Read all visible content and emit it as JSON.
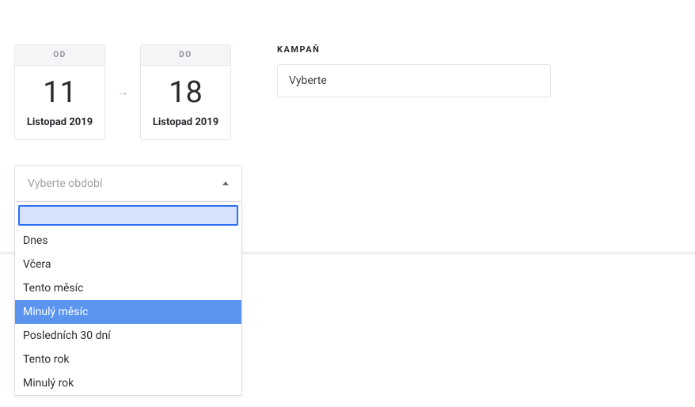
{
  "dateRange": {
    "from": {
      "label": "OD",
      "day": "11",
      "monthYear": "Listopad 2019"
    },
    "to": {
      "label": "DO",
      "day": "18",
      "monthYear": "Listopad 2019"
    }
  },
  "periodSelect": {
    "placeholder": "Vyberte období",
    "searchValue": "",
    "options": [
      {
        "label": "Dnes",
        "highlighted": false
      },
      {
        "label": "Včera",
        "highlighted": false
      },
      {
        "label": "Tento měsíc",
        "highlighted": false
      },
      {
        "label": "Minulý měsíc",
        "highlighted": true
      },
      {
        "label": "Posledních 30 dní",
        "highlighted": false
      },
      {
        "label": "Tento rok",
        "highlighted": false
      },
      {
        "label": "Minulý rok",
        "highlighted": false
      }
    ]
  },
  "campaign": {
    "label": "KAMPAŇ",
    "placeholder": "Vyberte"
  }
}
